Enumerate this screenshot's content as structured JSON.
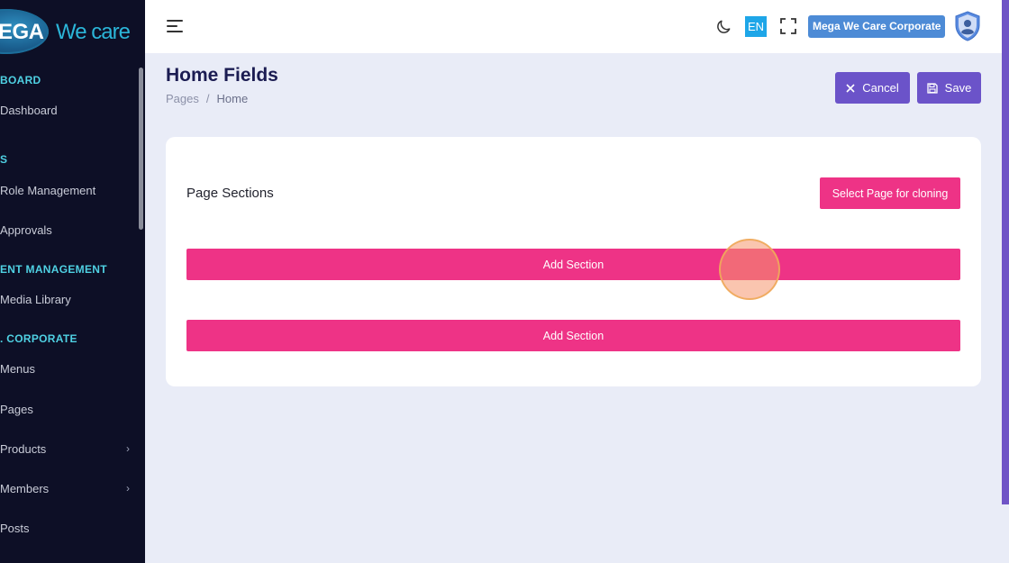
{
  "app": {
    "logo_left": "EGA",
    "logo_right": "We care"
  },
  "sidebar": {
    "headings": [
      "BOARD",
      "S",
      "ENT MANAGEMENT",
      ". CORPORATE"
    ],
    "items": [
      {
        "label": "Dashboard"
      },
      {
        "label": "Role Management"
      },
      {
        "label": "Approvals"
      },
      {
        "label": "Media Library"
      },
      {
        "label": "Menus"
      },
      {
        "label": "Pages"
      },
      {
        "label": "Products",
        "chevron": "›"
      },
      {
        "label": "Members",
        "chevron": "›"
      },
      {
        "label": "Posts"
      }
    ]
  },
  "topbar": {
    "language": "EN",
    "corporate": "Mega We Care Corporate"
  },
  "page": {
    "title": "Home Fields",
    "breadcrumb": [
      "Pages",
      "Home"
    ],
    "breadcrumb_sep": "/",
    "cancel_label": "Cancel",
    "save_label": "Save"
  },
  "card": {
    "title": "Page Sections",
    "clone_label": "Select Page for cloning",
    "add_section_label": "Add Section"
  },
  "colors": {
    "sidebar_bg": "#0d0f26",
    "accent_purple": "#6b53c9",
    "accent_pink": "#ee3386",
    "heading_cyan": "#4fd1e3"
  }
}
